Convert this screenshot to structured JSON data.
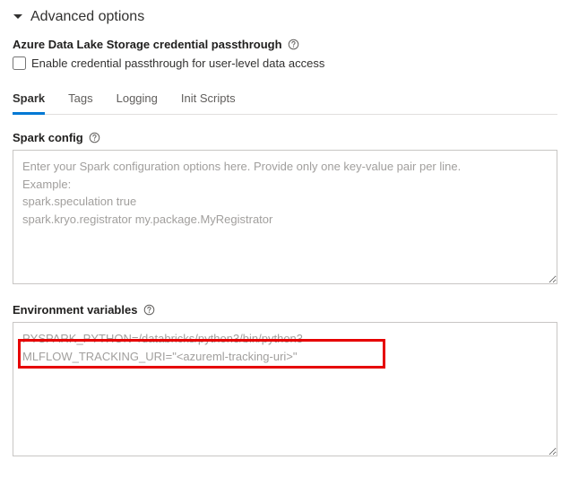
{
  "header": {
    "title": "Advanced options"
  },
  "passthrough": {
    "title": "Azure Data Lake Storage credential passthrough",
    "checkbox_label": "Enable credential passthrough for user-level data access"
  },
  "tabs": {
    "items": [
      {
        "label": "Spark"
      },
      {
        "label": "Tags"
      },
      {
        "label": "Logging"
      },
      {
        "label": "Init Scripts"
      }
    ]
  },
  "spark_config": {
    "label": "Spark config",
    "placeholder": "Enter your Spark configuration options here. Provide only one key-value pair per line.\nExample:\nspark.speculation true\nspark.kryo.registrator my.package.MyRegistrator"
  },
  "env_vars": {
    "label": "Environment variables",
    "value": "PYSPARK_PYTHON=/databricks/python3/bin/python3\nMLFLOW_TRACKING_URI=\"<azureml-tracking-uri>\""
  }
}
